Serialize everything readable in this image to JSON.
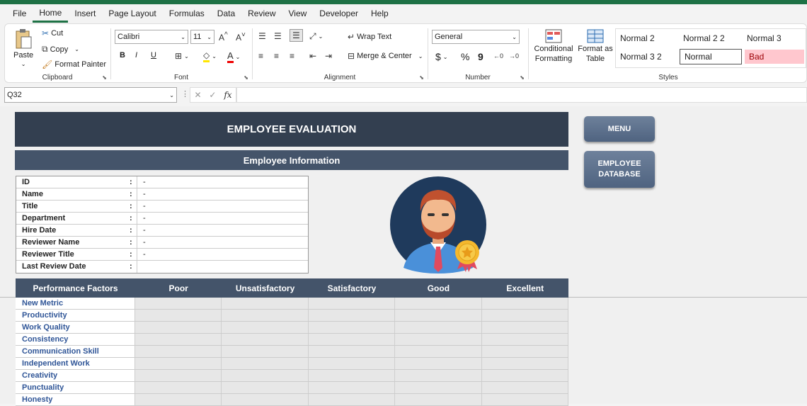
{
  "menu": [
    "File",
    "Home",
    "Insert",
    "Page Layout",
    "Formulas",
    "Data",
    "Review",
    "View",
    "Developer",
    "Help"
  ],
  "ribbon": {
    "clipboard": {
      "paste": "Paste",
      "cut": "Cut",
      "copy": "Copy",
      "format_painter": "Format Painter",
      "label": "Clipboard"
    },
    "font": {
      "family": "Calibri",
      "size": "11",
      "bold": "B",
      "italic": "I",
      "underline": "U",
      "label": "Font"
    },
    "alignment": {
      "wrap": "Wrap Text",
      "merge": "Merge & Center",
      "label": "Alignment"
    },
    "number": {
      "format": "General",
      "currency": "$",
      "percent": "%",
      "comma": "9",
      "label": "Number"
    },
    "styles": {
      "conditional": "Conditional",
      "conditional2": "Formatting",
      "format_as": "Format as",
      "format_as2": "Table",
      "cells": [
        "Normal 2",
        "Normal 2 2",
        "Normal 3",
        "Normal 3 2",
        "Normal",
        "Bad"
      ],
      "label": "Styles"
    }
  },
  "formula_bar": {
    "name_box": "Q32",
    "fx": "fx",
    "value": ""
  },
  "sheet": {
    "title": "EMPLOYEE EVALUATION",
    "info_header": "Employee Information",
    "info_rows": [
      {
        "label": "ID",
        "value": "-"
      },
      {
        "label": "Name",
        "value": "-"
      },
      {
        "label": "Title",
        "value": "-"
      },
      {
        "label": "Department",
        "value": "-"
      },
      {
        "label": "Hire Date",
        "value": "-"
      },
      {
        "label": "Reviewer Name",
        "value": "-"
      },
      {
        "label": "Reviewer Title",
        "value": "-"
      },
      {
        "label": "Last Review Date",
        "value": ""
      }
    ],
    "buttons": {
      "menu": "MENU",
      "database_line1": "EMPLOYEE",
      "database_line2": "DATABASE"
    },
    "perf_headers": [
      "Performance Factors",
      "Poor",
      "Unsatisfactory",
      "Satisfactory",
      "Good",
      "Excellent"
    ],
    "perf_rows": [
      "New Metric",
      "Productivity",
      "Work Quality",
      "Consistency",
      "Communication Skill",
      "Independent Work",
      "Creativity",
      "Punctuality",
      "Honesty"
    ]
  },
  "colors": {
    "dark_header": "#333f50",
    "sub_header": "#44546a",
    "factor_text": "#2f5597",
    "excel_green": "#1e7145"
  }
}
